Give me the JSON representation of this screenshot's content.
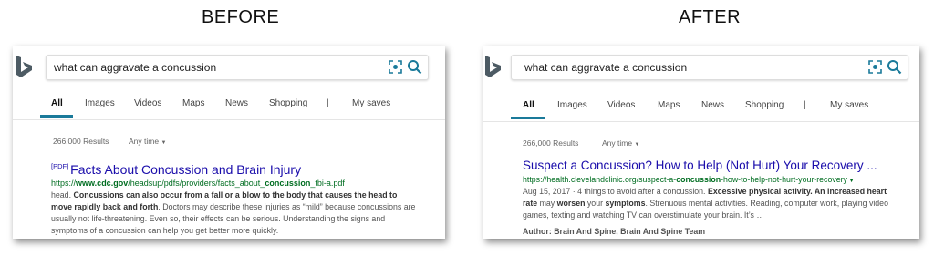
{
  "headings": {
    "before": "BEFORE",
    "after": "AFTER"
  },
  "before": {
    "search": {
      "query": "what can aggravate a concussion"
    },
    "tabs": [
      "All",
      "Images",
      "Videos",
      "Maps",
      "News",
      "Shopping",
      "|",
      "My saves"
    ],
    "results_count": "266,000 Results",
    "time_filter": "Any time",
    "result": {
      "tag": "[PDF]",
      "title": "Facts About Concussion and Brain Injury",
      "url_pre": "https://",
      "url_bold1": "www.cdc.gov",
      "url_mid": "/headsup/pdfs/providers/facts_about_",
      "url_bold2": "concussion",
      "url_post": "_tbi-a.pdf",
      "snippet_pre": "head. ",
      "snippet_bold": "Concussions can also occur from a fall or a blow to the body that causes the head to move rapidly back and forth",
      "snippet_post": ". Doctors may describe these injuries as “mild” because concussions are usually not life-threatening. Even so, their effects can be serious. Understanding the signs and symptoms of a concussion can help you get better more quickly."
    }
  },
  "after": {
    "search": {
      "query": "what can aggravate a concussion"
    },
    "tabs": [
      "All",
      "Images",
      "Videos",
      "Maps",
      "News",
      "Shopping",
      "|",
      "My saves"
    ],
    "results_count": "266,000 Results",
    "time_filter": "Any time",
    "result": {
      "title": "Suspect a Concussion? How to Help (Not Hurt) Your Recovery ...",
      "url_pre": "https://health.clevelandclinic.org/suspect-a-",
      "url_bold": "concussion",
      "url_post": "-how-to-help-not-hurt-your-recovery",
      "snippet_pre": "Aug 15, 2017 · 4 things to avoid after a concussion. ",
      "snippet_bold": "Excessive physical activity. An increased heart rate",
      "snippet_mid": " may ",
      "snippet_bold2": "worsen",
      "snippet_mid2": " your ",
      "snippet_bold3": "symptoms",
      "snippet_post": ". Strenuous mental activities. Reading, computer work, playing video games, texting and watching TV can overstimulate your brain. It’s …",
      "author": "Author: Brain And Spine, Brain And Spine Team"
    }
  },
  "colors": {
    "accent": "#1a7a9a",
    "link": "#1a0dab",
    "url": "#006d21",
    "logo": "#4d5b64"
  }
}
